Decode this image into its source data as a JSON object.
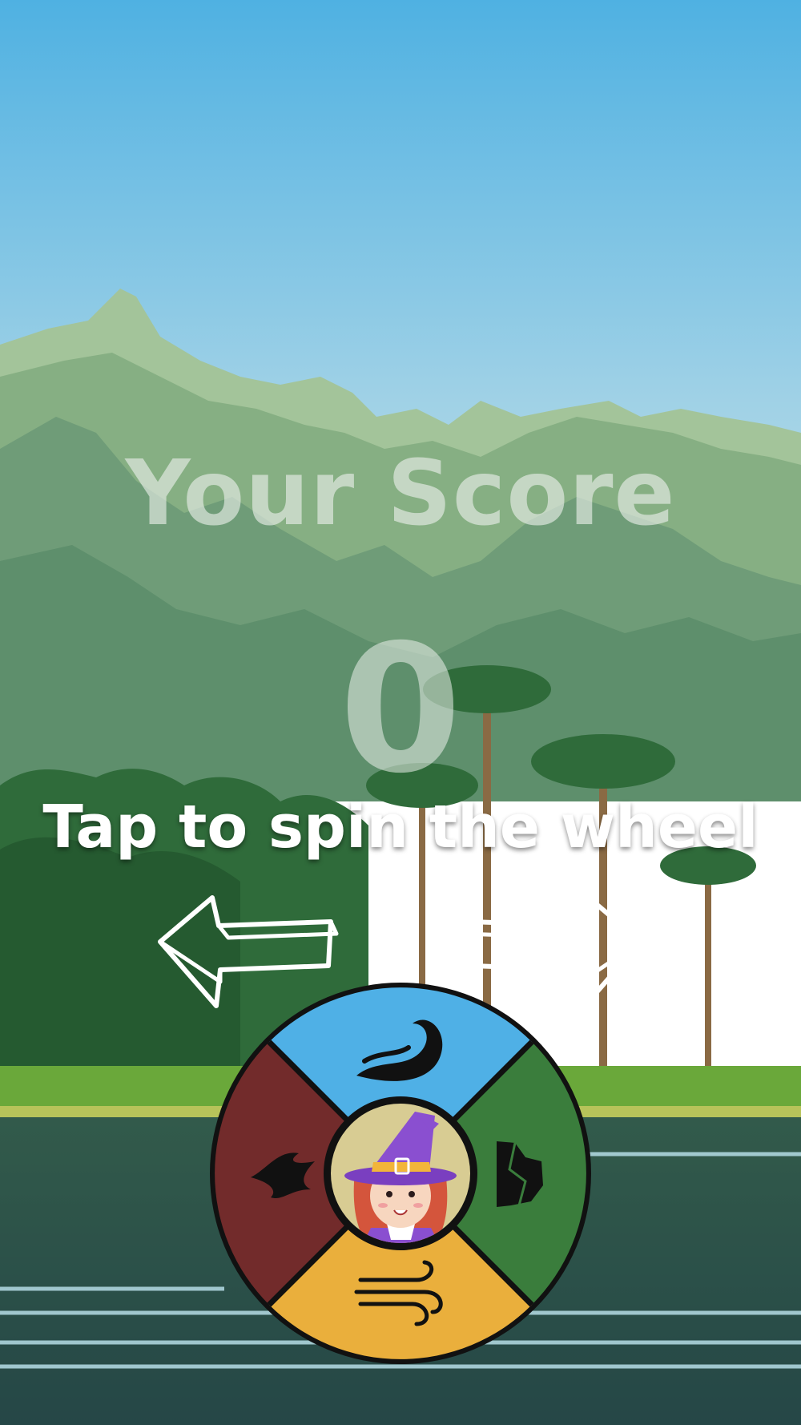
{
  "score": {
    "title": "Your Score",
    "value": "0"
  },
  "hint": "Tap to spin the wheel",
  "wheel": {
    "segments": [
      {
        "name": "water",
        "color": "#4fb0e6",
        "icon": "water-wave-icon"
      },
      {
        "name": "earth",
        "color": "#3a7d3c",
        "icon": "rock-icon"
      },
      {
        "name": "air",
        "color": "#eaaf3c",
        "icon": "wind-icon"
      },
      {
        "name": "fire",
        "color": "#722b2b",
        "icon": "flame-icon"
      }
    ],
    "center": {
      "color": "#d8cc93",
      "icon": "witch-avatar"
    }
  },
  "colors": {
    "sky_top": "#4fb1e2",
    "sky_bottom": "#c8e6e4",
    "mountain": "#7aa57d",
    "grass": "#7ab43e",
    "water": "#2f5a5a"
  }
}
